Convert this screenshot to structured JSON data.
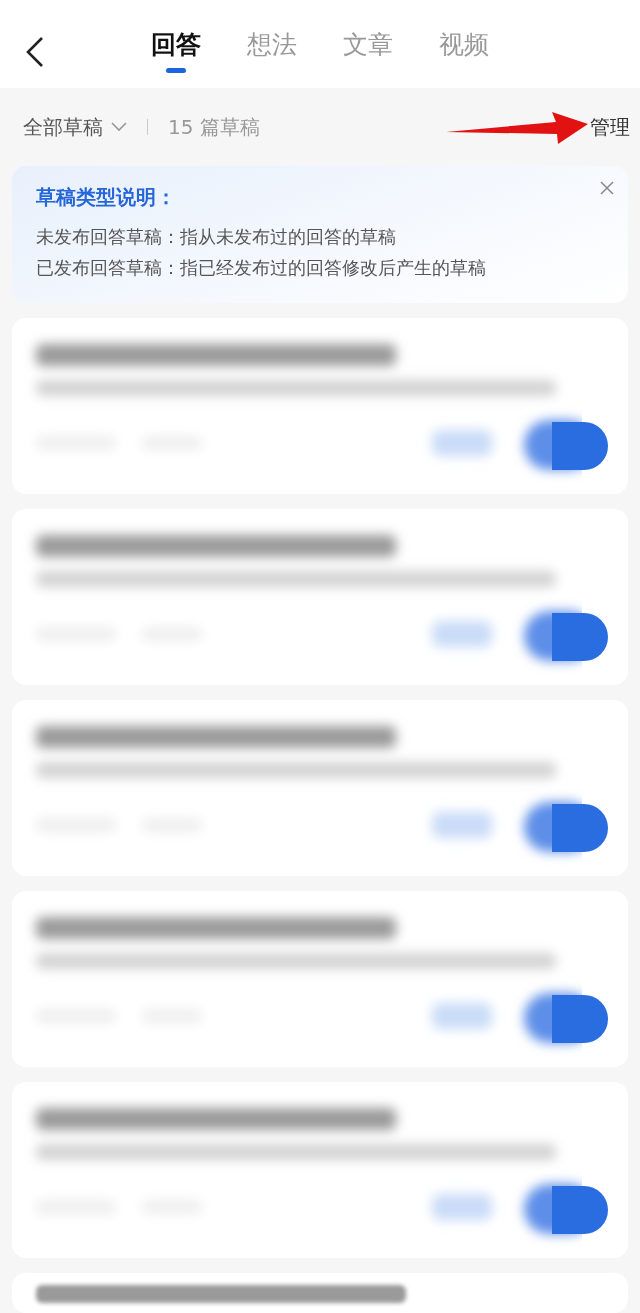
{
  "tabs": [
    {
      "label": "回答",
      "selected": true
    },
    {
      "label": "想法",
      "selected": false
    },
    {
      "label": "文章",
      "selected": false
    },
    {
      "label": "视频",
      "selected": false
    }
  ],
  "filter": {
    "label": "全部草稿",
    "count": "15 篇草稿",
    "manage": "管理"
  },
  "notice": {
    "title": "草稿类型说明：",
    "lines": [
      "未发布回答草稿：指从未发布过的回答的草稿",
      "已发布回答草稿：指已经发布过的回答修改后产生的草稿"
    ]
  },
  "drafts": [
    {
      "kind": "blurred"
    },
    {
      "kind": "blurred"
    },
    {
      "kind": "blurred"
    },
    {
      "kind": "blurred"
    },
    {
      "kind": "blurred"
    },
    {
      "kind": "blurred"
    }
  ]
}
